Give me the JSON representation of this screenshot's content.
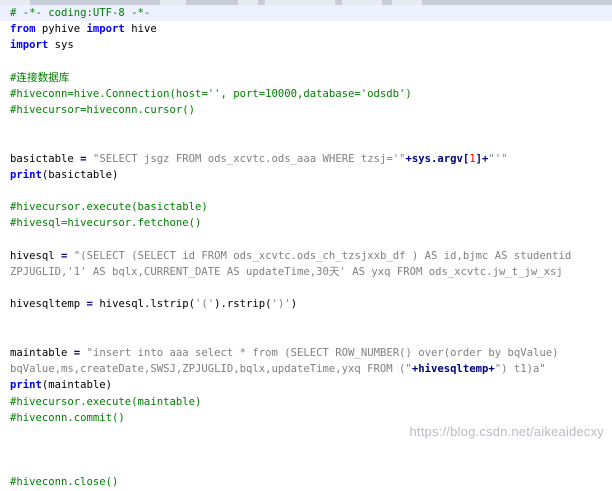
{
  "editor": {
    "lines": [
      [
        {
          "t": "# -*- coding:UTF-8 -*-",
          "c": "c-comment"
        }
      ],
      [
        {
          "t": "from",
          "c": "c-kw"
        },
        {
          "t": " pyhive ",
          "c": "c-id"
        },
        {
          "t": "import",
          "c": "c-kw"
        },
        {
          "t": " hive",
          "c": "c-id"
        }
      ],
      [
        {
          "t": "import",
          "c": "c-kw"
        },
        {
          "t": " sys",
          "c": "c-id"
        }
      ],
      [],
      [
        {
          "t": "#连接数据库",
          "c": "c-comment"
        }
      ],
      [
        {
          "t": "#hiveconn=hive.Connection(host='', port=10000,database='odsdb')",
          "c": "c-comment"
        }
      ],
      [
        {
          "t": "#hivecursor=hiveconn.cursor()",
          "c": "c-comment"
        }
      ],
      [],
      [],
      [
        {
          "t": "basictable ",
          "c": "c-id"
        },
        {
          "t": "=",
          "c": "c-op"
        },
        {
          "t": " ",
          "c": "c-id"
        },
        {
          "t": "\"SELECT jsgz FROM ods_xcvtc.ods_aaa WHERE tzsj='\"",
          "c": "c-str"
        },
        {
          "t": "+sys.argv[",
          "c": "c-op"
        },
        {
          "t": "1",
          "c": "c-num"
        },
        {
          "t": "]+",
          "c": "c-op"
        },
        {
          "t": "\"'\"",
          "c": "c-str"
        }
      ],
      [
        {
          "t": "print",
          "c": "c-kw"
        },
        {
          "t": "(basictable)",
          "c": "c-id"
        }
      ],
      [],
      [
        {
          "t": "#hivecursor.execute(basictable)",
          "c": "c-comment"
        }
      ],
      [
        {
          "t": "#hivesql=hivecursor.fetchone()",
          "c": "c-comment"
        }
      ],
      [],
      [
        {
          "t": "hivesql ",
          "c": "c-id"
        },
        {
          "t": "=",
          "c": "c-op"
        },
        {
          "t": " ",
          "c": "c-id"
        },
        {
          "t": "\"(SELECT (SELECT id FROM ods_xcvtc.ods_ch_tzsjxxb_df ) AS id,bjmc AS studentid",
          "c": "c-str"
        }
      ],
      [
        {
          "t": "ZPJUGLID,'1' AS bqlx,CURRENT_DATE AS updateTime,30天' AS yxq FROM ods_xcvtc.jw_t_jw_xsj",
          "c": "c-str"
        }
      ],
      [],
      [
        {
          "t": "hivesqltemp ",
          "c": "c-id"
        },
        {
          "t": "=",
          "c": "c-op"
        },
        {
          "t": " hivesql.lstrip(",
          "c": "c-id"
        },
        {
          "t": "'('",
          "c": "c-str"
        },
        {
          "t": ").rstrip(",
          "c": "c-id"
        },
        {
          "t": "')'",
          "c": "c-str"
        },
        {
          "t": ")",
          "c": "c-id"
        }
      ],
      [],
      [],
      [
        {
          "t": "maintable ",
          "c": "c-id"
        },
        {
          "t": "=",
          "c": "c-op"
        },
        {
          "t": " ",
          "c": "c-id"
        },
        {
          "t": "\"insert into aaa select * from (SELECT ROW_NUMBER() over(order by bqValue)",
          "c": "c-str"
        }
      ],
      [
        {
          "t": "bqValue,ms,createDate,SWSJ,ZPJUGLID,bqlx,updateTime,yxq FROM (\"",
          "c": "c-str"
        },
        {
          "t": "+hivesqltemp+",
          "c": "c-op"
        },
        {
          "t": "\") t1)a\"",
          "c": "c-str"
        }
      ],
      [
        {
          "t": "print",
          "c": "c-kw"
        },
        {
          "t": "(maintable)",
          "c": "c-id"
        }
      ],
      [
        {
          "t": "#hivecursor.execute(maintable)",
          "c": "c-comment"
        }
      ],
      [
        {
          "t": "#hiveconn.commit()",
          "c": "c-comment"
        }
      ],
      [],
      [],
      [],
      [
        {
          "t": "#hiveconn.close()",
          "c": "c-comment"
        }
      ]
    ]
  },
  "watermark": "https://blog.csdn.net/aikeaidecxy"
}
